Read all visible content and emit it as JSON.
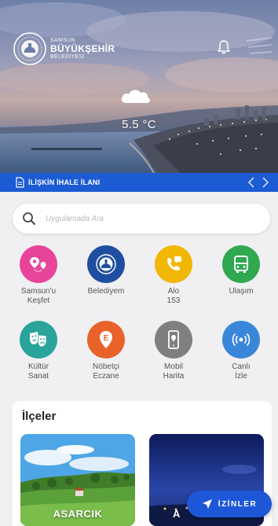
{
  "header": {
    "brand_top": "SAMSUN",
    "brand_main": "BÜYÜKŞEHİR",
    "brand_sub": "BELEDİYESİ",
    "weather_icon": "cloud-icon",
    "temperature": "5.5 °C"
  },
  "ticker": {
    "text": "İLİŞKİN İHALE İLANI"
  },
  "search": {
    "placeholder": "Uygulamada Ara"
  },
  "shortcuts": [
    {
      "label": "Samsun'u\nKeşfet",
      "color": "#e8449a",
      "icon": "map-pins-icon"
    },
    {
      "label": "Belediyem",
      "color": "#1f4ea0",
      "icon": "city-hall-icon"
    },
    {
      "label": "Alo\n153",
      "color": "#f2b705",
      "icon": "phone-icon"
    },
    {
      "label": "Ulaşım",
      "color": "#2fa84f",
      "icon": "bus-icon"
    },
    {
      "label": "Kültür\nSanat",
      "color": "#2aa39a",
      "icon": "theater-masks-icon"
    },
    {
      "label": "Nöbetçi\nEczane",
      "color": "#e8622a",
      "icon": "pharmacy-icon"
    },
    {
      "label": "Mobil\nHarita",
      "color": "#7f7f7f",
      "icon": "mobile-map-icon"
    },
    {
      "label": "Canlı\nİzle",
      "color": "#3a86d9",
      "icon": "live-broadcast-icon"
    }
  ],
  "districts": {
    "title": "İlçeler",
    "cards": [
      {
        "name": "ASARCIK"
      },
      {
        "name": "A"
      }
    ]
  },
  "fab": {
    "label": "İZİNLER",
    "icon": "navigation-arrow-icon"
  }
}
